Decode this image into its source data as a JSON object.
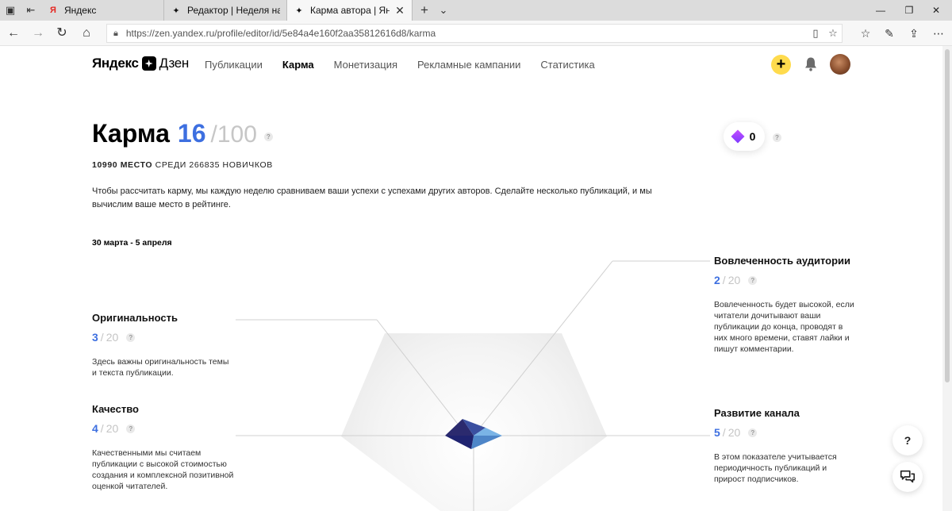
{
  "browser": {
    "tabs": [
      {
        "label": "Яндекс",
        "favicon": "Я"
      },
      {
        "label": "Редактор | Неделя на Дзен",
        "favicon": "zen"
      },
      {
        "label": "Карма автора | Яндекс",
        "favicon": "zen"
      }
    ],
    "url": "https://zen.yandex.ru/profile/editor/id/5e84a4e160f2aa35812616d8/karma"
  },
  "header": {
    "logo_yandex": "Яндекс",
    "logo_dzen": "Дзен",
    "nav": [
      "Публикации",
      "Карма",
      "Монетизация",
      "Рекламные кампании",
      "Статистика"
    ],
    "active_nav": "Карма",
    "plus_label": "+"
  },
  "karma": {
    "title": "Карма",
    "score": "16",
    "max": "/100",
    "diamonds": "0",
    "rank_place": "10990 место",
    "rank_rest": "среди 266835 новичков",
    "description": "Чтобы рассчитать карму, мы каждую неделю сравниваем ваши успехи с успехами других авторов. Сделайте несколько публикаций, и мы вычислим ваше место в рейтинге.",
    "period": "30 марта - 5 апреля"
  },
  "metrics": {
    "originality": {
      "title": "Оригинальность",
      "value": "3",
      "max": "20",
      "text": "Здесь важны оригинальность темы и текста публикации."
    },
    "quality": {
      "title": "Качество",
      "value": "4",
      "max": "20",
      "text": "Качественными мы считаем публикации с высокой стоимостью создания и комплексной позитивной оценкой читателей."
    },
    "engagement": {
      "title": "Вовлеченность аудитории",
      "value": "2",
      "max": "20",
      "text": "Вовлеченность будет высокой, если читатели дочитывают ваши публикации до конца, проводят в них много времени, ставят лайки и пишут комментарии."
    },
    "growth": {
      "title": "Развитие канала",
      "value": "5",
      "max": "20",
      "text": "В этом показателе учитывается периодичность публикаций и прирост подписчиков."
    }
  },
  "help": {
    "question": "?"
  },
  "colors": {
    "accent": "#3d6fe0",
    "plus": "#ffdb4d",
    "diamond": "#a43dff"
  }
}
